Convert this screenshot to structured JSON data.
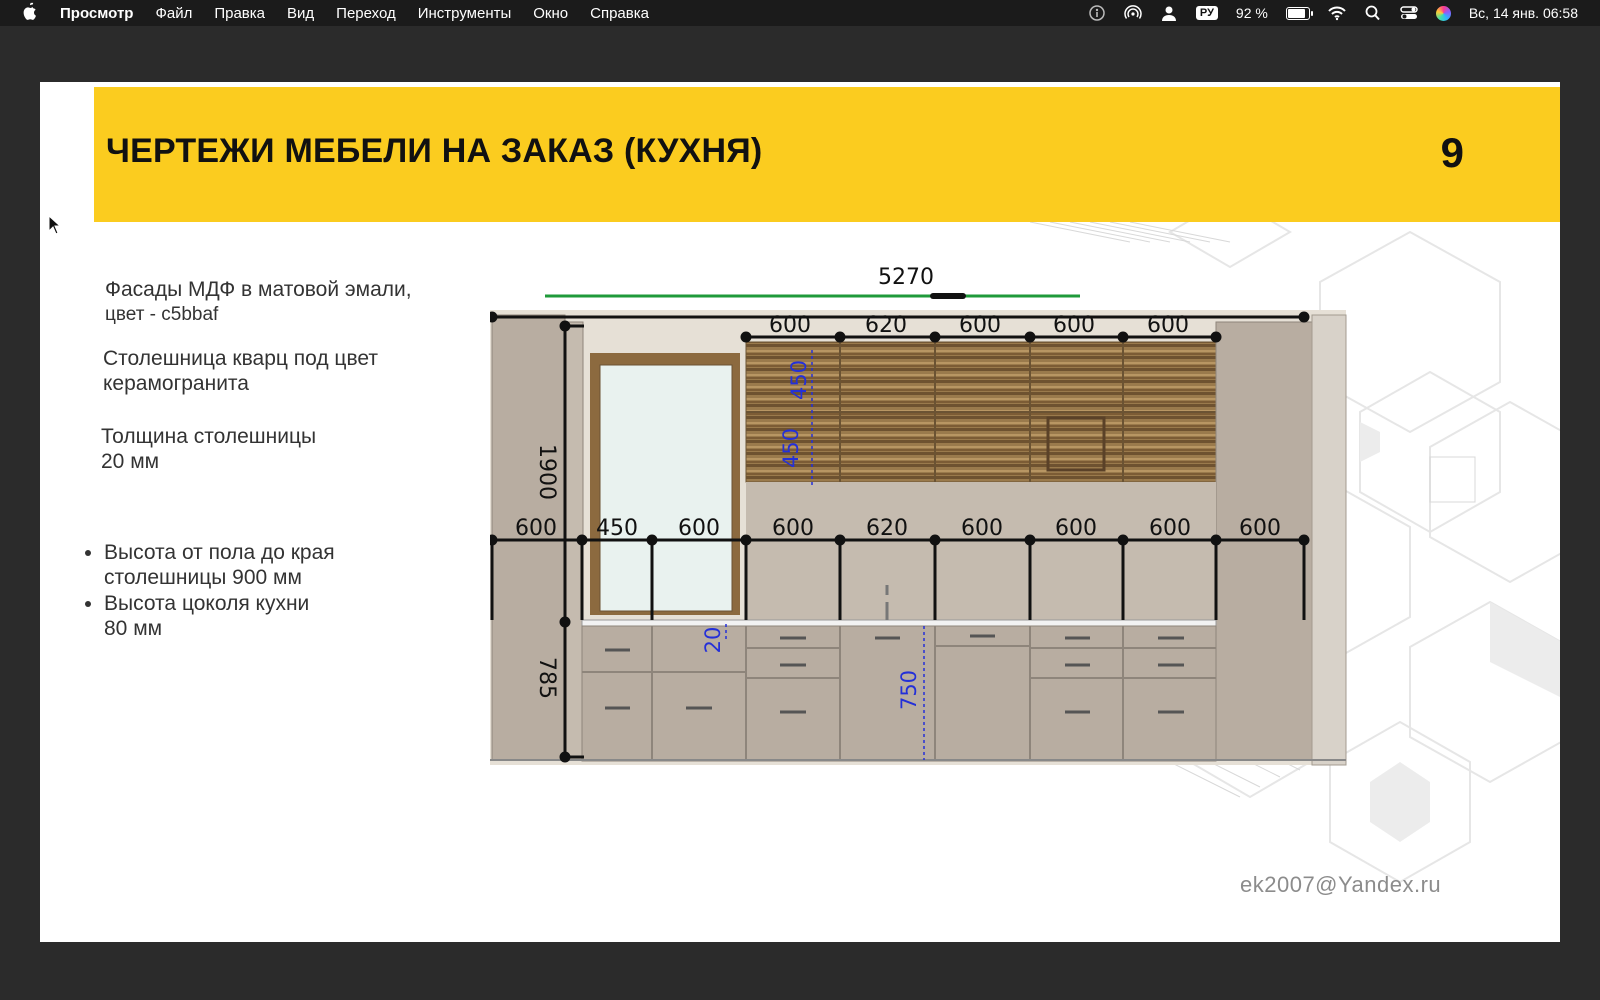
{
  "menubar": {
    "apple_icon": "apple-logo-icon",
    "app_name": "Просмотр",
    "items": [
      "Файл",
      "Правка",
      "Вид",
      "Переход",
      "Инструменты",
      "Окно",
      "Справка"
    ],
    "input_language": "РУ",
    "battery_percent": "92 %",
    "battery_level": 0.92,
    "datetime": "Вс, 14 янв. 06:58"
  },
  "slide": {
    "title": "ЧЕРТЕЖИ МЕБЕЛИ НА ЗАКАЗ (КУХНЯ)",
    "page_number": "9",
    "accent_color": "#fbcc1f",
    "facades_line1": "Фасады МДФ в матовой эмали,",
    "facades_line2": "цвет - c5bbaf",
    "countertop_line1": "Столешница кварц под цвет",
    "countertop_line2": "керамогранита",
    "thickness_line1": "Толщина столешницы",
    "thickness_line2": "20 мм",
    "bullets": [
      {
        "line1": "Высота от пола до края",
        "line2": "столешницы 900 мм"
      },
      {
        "line1": "Высота цоколя кухни",
        "line2": "80 мм"
      }
    ],
    "email": "ek2007@Yandex.ru"
  },
  "drawing": {
    "total_width": "5270",
    "height_left": "1900",
    "height_lower": "785",
    "upper_dims": [
      "600",
      "620",
      "600",
      "600",
      "600"
    ],
    "lower_dims": [
      "600",
      "450",
      "600",
      "600",
      "620",
      "600",
      "600",
      "600",
      "600"
    ],
    "blue_dims": {
      "upper_1": "450",
      "upper_2": "450",
      "countertop": "20",
      "lower": "750"
    }
  }
}
